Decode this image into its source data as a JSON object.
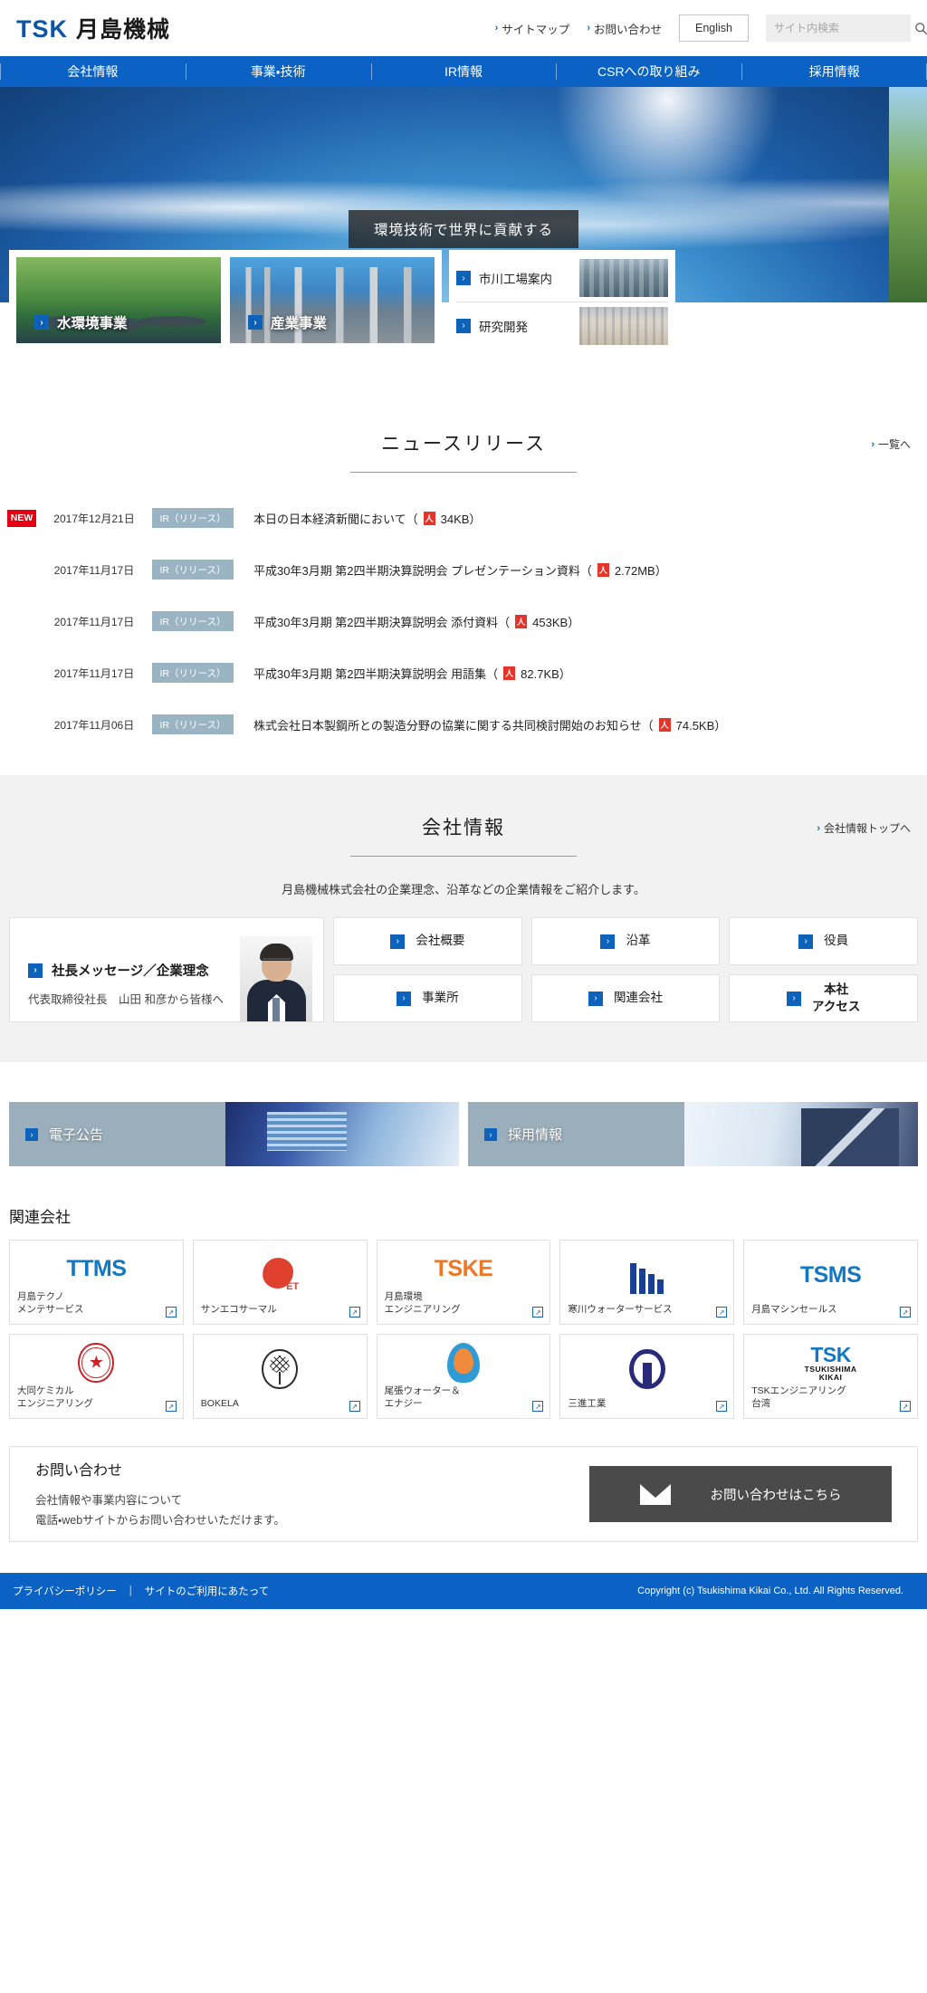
{
  "header": {
    "logo_tsk": "TSK",
    "logo_jp": "月島機械",
    "links": [
      {
        "label": "サイトマップ",
        "icon": "chevron-right-icon"
      },
      {
        "label": "お問い合わせ",
        "icon": "chevron-right-icon"
      }
    ],
    "english_button": "English",
    "search_placeholder": "サイト内検索"
  },
  "nav": {
    "items": [
      {
        "label": "会社情報"
      },
      {
        "label": "事業・技術"
      },
      {
        "label": "IR情報"
      },
      {
        "label": "CSRへの取り組み"
      },
      {
        "label": "採用情報"
      }
    ]
  },
  "hero": {
    "caption": "環境技術で世界に貢献する",
    "business_cards": [
      {
        "label": "水環境事業"
      },
      {
        "label": "産業事業"
      }
    ],
    "sub_links": [
      {
        "label": "市川工場案内"
      },
      {
        "label": "研究開発"
      }
    ]
  },
  "news": {
    "title": "ニュースリリース",
    "more_label": "一覧へ",
    "new_badge": "NEW",
    "items": [
      {
        "is_new": true,
        "date": "2017年12月21日",
        "tag": "IR（リリース）",
        "title": "本日の日本経済新聞において（",
        "filesize": "34KB）"
      },
      {
        "is_new": false,
        "date": "2017年11月17日",
        "tag": "IR（リリース）",
        "title": "平成30年3月期 第2四半期決算説明会 プレゼンテーション資料（",
        "filesize": "2.72MB）"
      },
      {
        "is_new": false,
        "date": "2017年11月17日",
        "tag": "IR（リリース）",
        "title": "平成30年3月期 第2四半期決算説明会 添付資料（",
        "filesize": "453KB）"
      },
      {
        "is_new": false,
        "date": "2017年11月17日",
        "tag": "IR（リリース）",
        "title": "平成30年3月期 第2四半期決算説明会 用語集（",
        "filesize": "82.7KB）"
      },
      {
        "is_new": false,
        "date": "2017年11月06日",
        "tag": "IR（リリース）",
        "title": "株式会社日本製鋼所との製造分野の協業に関する共同検討開始のお知らせ（",
        "filesize": "74.5KB）"
      }
    ]
  },
  "company": {
    "title": "会社情報",
    "more_label": "会社情報トップへ",
    "lead": "月島機械株式会社の企業理念、沿革などの企業情報をご紹介します。",
    "president_card": {
      "title": "社長メッセージ／企業理念",
      "subtitle": "代表取締役社長　山田 和彦から皆様へ"
    },
    "buttons": [
      {
        "label": "会社概要"
      },
      {
        "label": "沿革"
      },
      {
        "label": "役員"
      },
      {
        "label": "事業所"
      },
      {
        "label": "関連会社"
      },
      {
        "label": "本社\nアクセス"
      }
    ]
  },
  "banners": [
    {
      "label": "電子公告"
    },
    {
      "label": "採用情報"
    }
  ],
  "affiliates": {
    "heading": "関連会社",
    "items": [
      {
        "logo_text": "TTMS",
        "logo_kind": "ttms",
        "name": "月島テクノ\nメンテサービス"
      },
      {
        "logo_text": "ET",
        "logo_kind": "sanec",
        "name": "サンエコサーマル"
      },
      {
        "logo_text": "TSKE",
        "logo_kind": "tske",
        "name": "月島環境\nエンジニアリング"
      },
      {
        "logo_text": "",
        "logo_kind": "samukawa",
        "name": "寒川ウォーターサービス"
      },
      {
        "logo_text": "TSMS",
        "logo_kind": "tsms",
        "name": "月島マシンセールス"
      },
      {
        "logo_text": "",
        "logo_kind": "daido",
        "name": "大同ケミカル\nエンジニアリング"
      },
      {
        "logo_text": "",
        "logo_kind": "bokela",
        "name": "BOKELA"
      },
      {
        "logo_text": "",
        "logo_kind": "owari",
        "name": "尾張ウォーター＆\nエナジー"
      },
      {
        "logo_text": "",
        "logo_kind": "sanshin",
        "name": "三進工業"
      },
      {
        "logo_text": "TSK",
        "logo_kind": "tsk_kikai",
        "logo_sub1": "TSUKISHIMA",
        "logo_sub2": "KIKAI",
        "name": "TSKエンジニアリング\n台湾"
      }
    ]
  },
  "contact": {
    "title": "お問い合わせ",
    "desc_line1": "会社情報や事業内容について",
    "desc_line2": "電話・webサイトからお問い合わせいただけます。",
    "button_label": "お問い合わせはこちら"
  },
  "footer": {
    "links": [
      {
        "label": "プライバシーポリシー"
      },
      {
        "label": "サイトのご利用にあたって"
      }
    ],
    "divider": "|",
    "copyright": "Copyright (c) Tsukishima Kikai Co., Ltd. All Rights Reserved."
  },
  "icons": {
    "chevron": "›",
    "pdf": "人",
    "external": "↗"
  }
}
